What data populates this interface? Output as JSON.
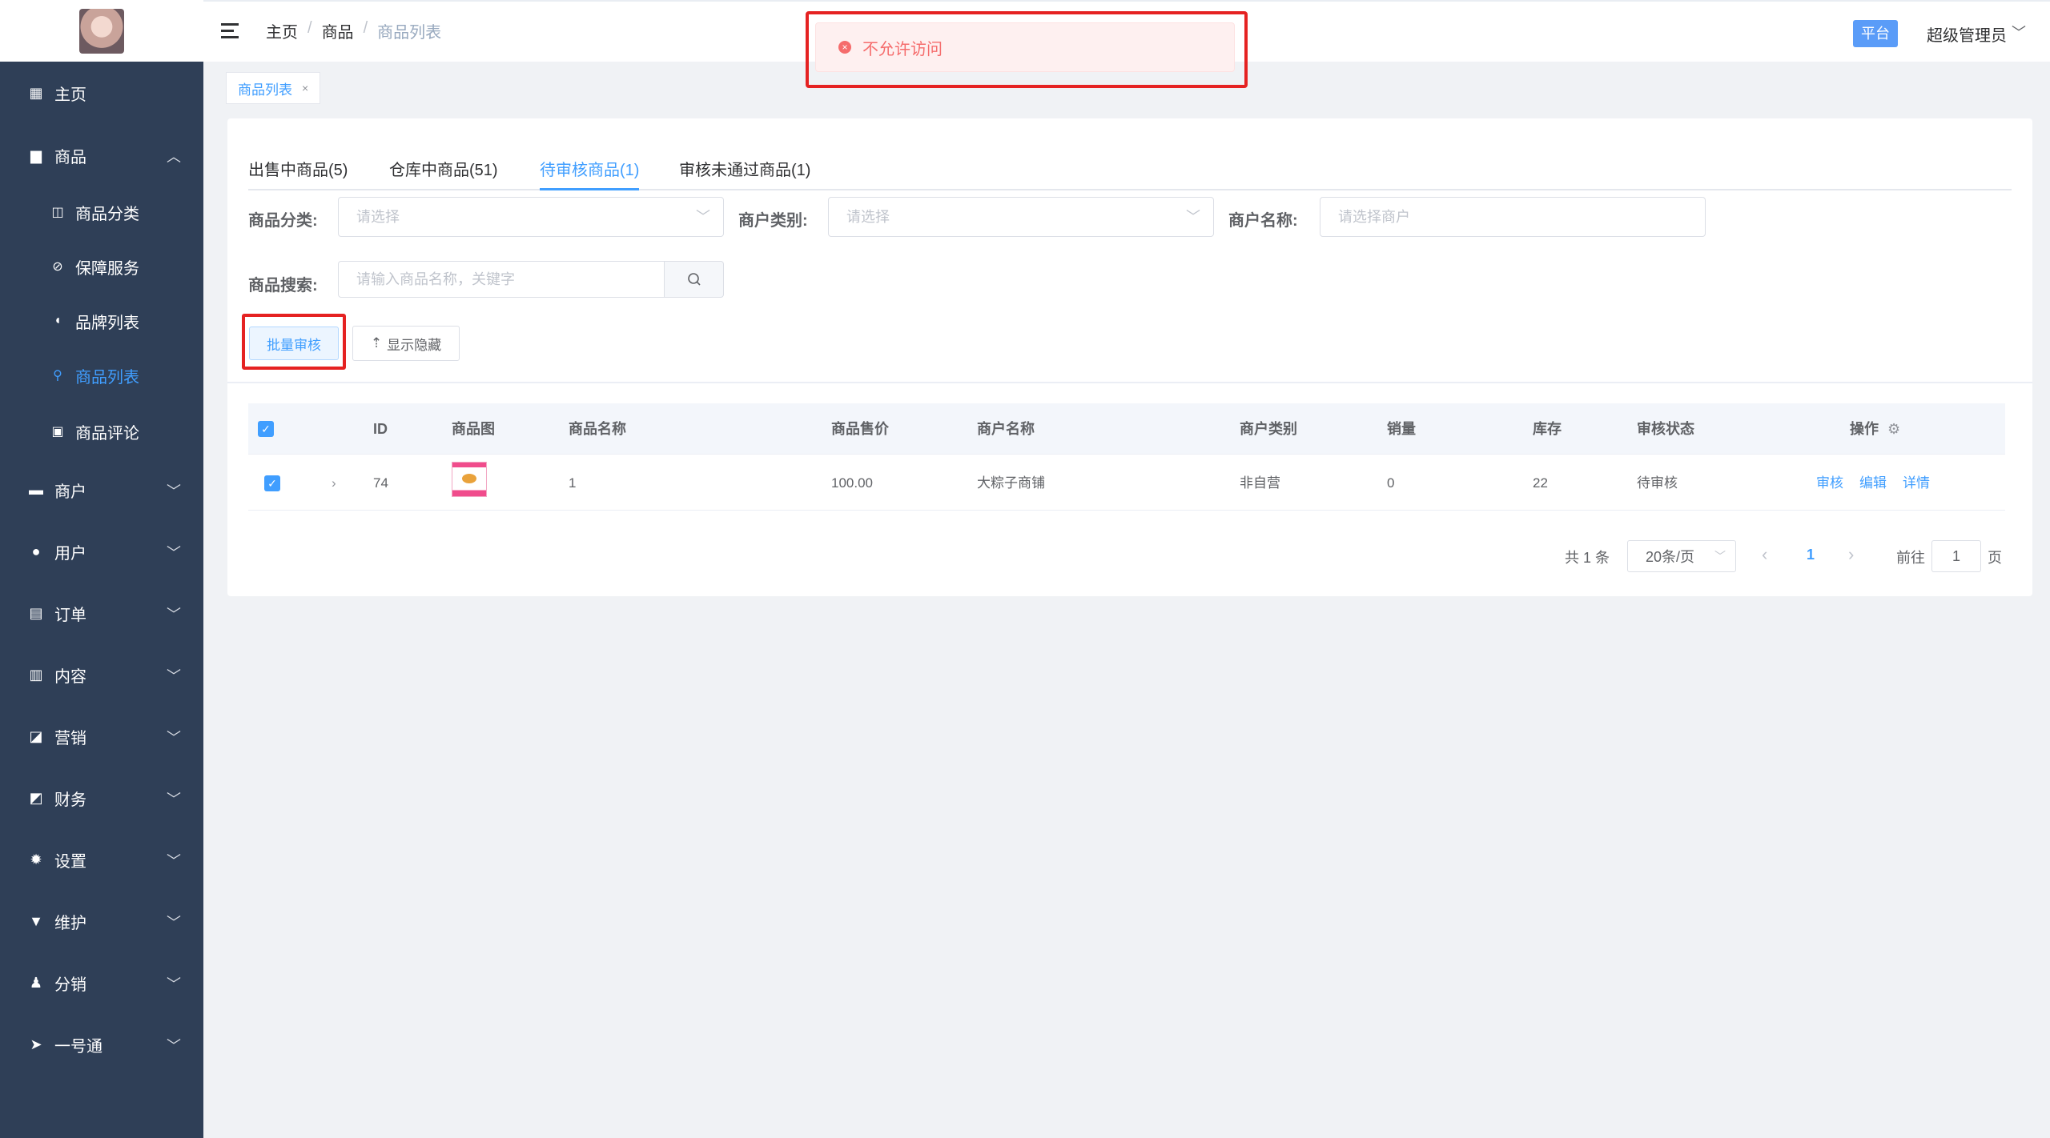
{
  "sidebar": {
    "items": [
      {
        "label": "主页",
        "icon": "grid-icon"
      },
      {
        "label": "商品",
        "icon": "bag-icon"
      },
      {
        "label": "商户",
        "icon": "store-icon"
      },
      {
        "label": "用户",
        "icon": "user-icon"
      },
      {
        "label": "订单",
        "icon": "clipboard-icon"
      },
      {
        "label": "内容",
        "icon": "book-icon"
      },
      {
        "label": "营销",
        "icon": "chart-icon"
      },
      {
        "label": "财务",
        "icon": "wallet-icon"
      },
      {
        "label": "设置",
        "icon": "gear-icon"
      },
      {
        "label": "维护",
        "icon": "tool-icon"
      },
      {
        "label": "分销",
        "icon": "share-user-icon"
      },
      {
        "label": "一号通",
        "icon": "paper-plane-icon"
      }
    ],
    "sub_items": [
      {
        "label": "商品分类",
        "icon": "tag-icon"
      },
      {
        "label": "保障服务",
        "icon": "shield-icon"
      },
      {
        "label": "品牌列表",
        "icon": "pin-icon"
      },
      {
        "label": "商品列表",
        "icon": "key-icon"
      },
      {
        "label": "商品评论",
        "icon": "comment-icon"
      }
    ],
    "active_color": "#409eff"
  },
  "header": {
    "breadcrumb": [
      "主页",
      "商品",
      "商品列表"
    ],
    "role_badge": "平台",
    "user_name": "超级管理员"
  },
  "toast": {
    "message": "不允许访问",
    "color": "#f56c6c"
  },
  "tags": {
    "active": "商品列表"
  },
  "tabs": [
    {
      "label": "出售中商品(5)"
    },
    {
      "label": "仓库中商品(51)"
    },
    {
      "label": "待审核商品(1)"
    },
    {
      "label": "审核未通过商品(1)"
    }
  ],
  "filters": {
    "category_label": "商品分类:",
    "category_placeholder": "请选择",
    "merchant_type_label": "商户类别:",
    "merchant_type_placeholder": "请选择",
    "merchant_name_label": "商户名称:",
    "merchant_name_placeholder": "请选择商户",
    "search_label": "商品搜索:",
    "search_placeholder": "请输入商品名称，关键字"
  },
  "actions": {
    "batch_review": "批量审核",
    "toggle_hidden": "显示隐藏"
  },
  "table": {
    "columns": [
      "ID",
      "商品图",
      "商品名称",
      "商品售价",
      "商户名称",
      "商户类别",
      "销量",
      "库存",
      "审核状态",
      "操作"
    ],
    "rows": [
      {
        "id": "74",
        "name": "1",
        "price": "100.00",
        "merchant": "大粽子商铺",
        "merchant_type": "非自营",
        "sales": "0",
        "stock": "22",
        "status": "待审核",
        "ops": [
          "审核",
          "编辑",
          "详情"
        ]
      }
    ]
  },
  "pagination": {
    "total": "共 1 条",
    "page_size": "20条/页",
    "current": "1",
    "goto_label": "前往",
    "goto_value": "1",
    "page_suffix": "页"
  },
  "colors": {
    "sidebar_bg": "#2f3f57",
    "accent": "#409eff",
    "highlight_frame": "#e52222"
  }
}
